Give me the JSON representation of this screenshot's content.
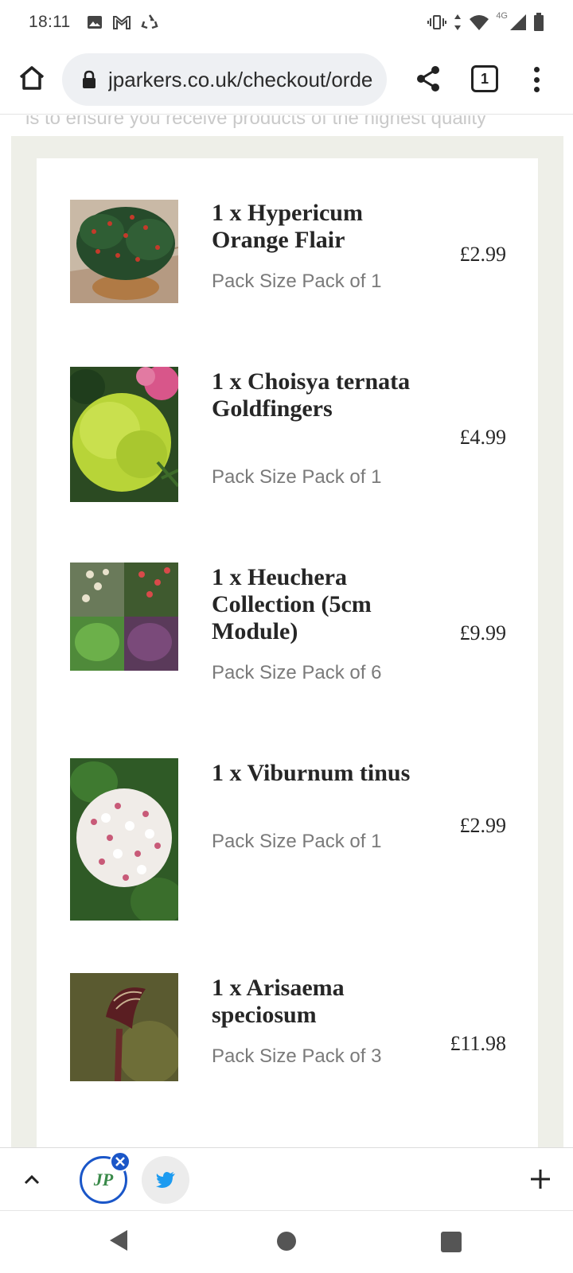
{
  "status_bar": {
    "time": "18:11",
    "network": "4G",
    "icons": [
      "image-icon",
      "gmail-icon",
      "recycle-icon",
      "vibrate-icon",
      "data-arrows-icon",
      "wifi-icon",
      "signal-icon",
      "battery-icon"
    ]
  },
  "browser": {
    "url": "jparkers.co.uk/checkout/orde",
    "tab_count": "1",
    "icons": [
      "home-icon",
      "lock-icon",
      "share-icon",
      "tabs-icon",
      "more-icon"
    ]
  },
  "page": {
    "faded_text": "is to ensure you receive products of the highest quality",
    "items": [
      {
        "title": "1 x Hypericum Orange Flair",
        "pack": "Pack Size Pack of 1",
        "price": "£2.99"
      },
      {
        "title": "1 x Choisya ternata Goldfingers",
        "pack": "Pack Size Pack of 1",
        "price": "£4.99"
      },
      {
        "title": "1 x Heuchera Collection (5cm Module)",
        "pack": "Pack Size Pack of 6",
        "price": "£9.99"
      },
      {
        "title": "1 x Viburnum tinus",
        "pack": "Pack Size Pack of 1",
        "price": "£2.99"
      },
      {
        "title": "1 x Arisaema speciosum",
        "pack": "Pack Size Pack of 3",
        "price": "£11.98"
      }
    ]
  },
  "tab_strip": {
    "jp_logo": "JP",
    "icons": [
      "chevron-up-icon",
      "close-icon",
      "twitter-icon",
      "plus-icon"
    ],
    "accent": "#1a56c8"
  },
  "colors": {
    "panel_bg": "#eeefe8",
    "title_text": "#262626",
    "pack_text": "#7a7a7a"
  }
}
